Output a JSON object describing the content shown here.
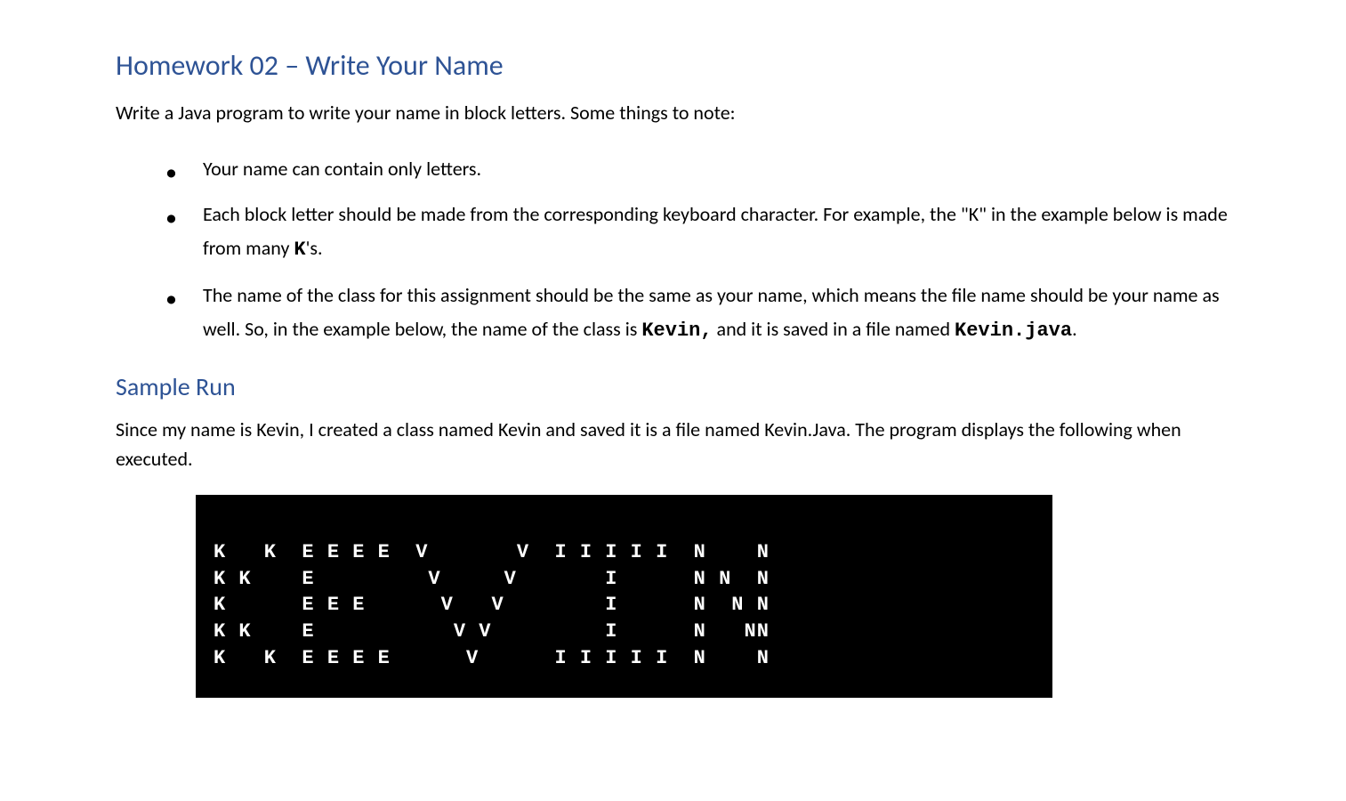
{
  "title": "Homework 02 – Write Your Name",
  "intro": "Write a Java program to write your name in block letters. Some things to note:",
  "bullets": [
    {
      "text": "Your name can contain only letters."
    },
    {
      "prefix": "Each block letter should be made from the corresponding keyboard character. For example, the \"K\" in the example below is made from many ",
      "code1": "K",
      "suffix": "'s."
    },
    {
      "prefix": "The name of the class for this assignment should be the same as your name, which means the file name should be your name as well. So, in the example below, the name of the class is ",
      "code1": "Kevin,",
      "middle": " and it is saved in a file named ",
      "code2": "Kevin.java",
      "suffix": "."
    }
  ],
  "sample_heading": "Sample Run",
  "sample_desc": "Since my name is Kevin, I created a class named Kevin and saved it is a file named Kevin.Java. The program displays the following when executed.",
  "output_lines": [
    "K   K  E E E E  V       V  I I I I I  N    N",
    "K K    E         V     V       I      N N  N",
    "K      E E E      V   V        I      N  N N",
    "K K    E           V V         I      N   NN",
    "K   K  E E E E      V      I I I I I  N    N"
  ]
}
